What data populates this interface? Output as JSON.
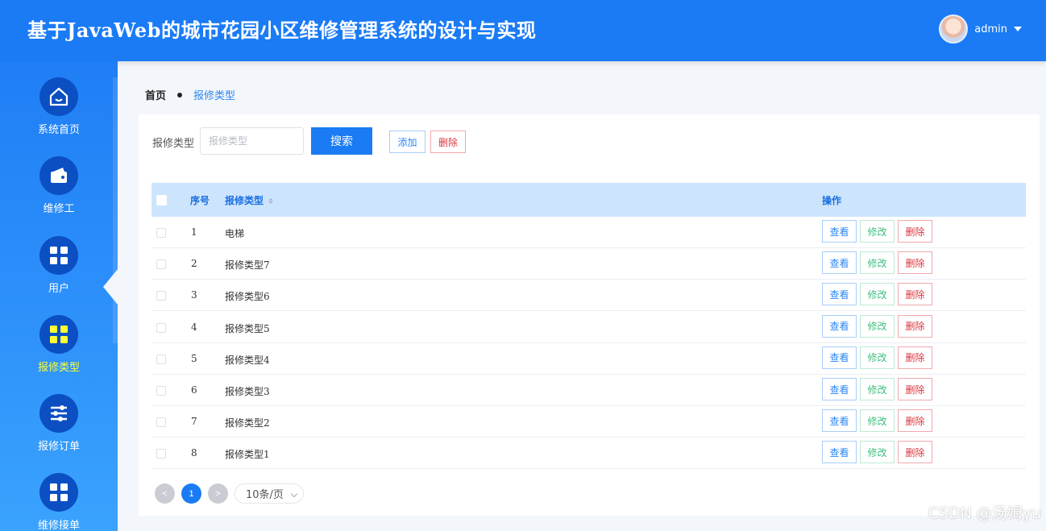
{
  "header": {
    "title": "基于JavaWeb的城市花园小区维修管理系统的设计与实现",
    "username": "admin"
  },
  "sidebar": {
    "items": [
      {
        "label": "系统首页",
        "icon": "home-icon"
      },
      {
        "label": "维修工",
        "icon": "wallet-icon"
      },
      {
        "label": "用户",
        "icon": "grid-icon"
      },
      {
        "label": "报修类型",
        "icon": "grid-icon",
        "active": true
      },
      {
        "label": "报修订单",
        "icon": "sliders-icon"
      },
      {
        "label": "维修接单",
        "icon": "grid-icon"
      }
    ],
    "active_icon_color": "#ffff33"
  },
  "breadcrumb": {
    "home": "首页",
    "current": "报修类型"
  },
  "toolbar": {
    "search_label": "报修类型",
    "search_placeholder": "报修类型",
    "search_button": "搜索",
    "add_button": "添加",
    "delete_button": "删除"
  },
  "table": {
    "columns": {
      "index": "序号",
      "type": "报修类型",
      "actions": "操作"
    },
    "action_labels": {
      "view": "查看",
      "edit": "修改",
      "delete": "删除"
    },
    "rows": [
      {
        "index": "1",
        "type": "电梯"
      },
      {
        "index": "2",
        "type": "报修类型7"
      },
      {
        "index": "3",
        "type": "报修类型6"
      },
      {
        "index": "4",
        "type": "报修类型5"
      },
      {
        "index": "5",
        "type": "报修类型4"
      },
      {
        "index": "6",
        "type": "报修类型3"
      },
      {
        "index": "7",
        "type": "报修类型2"
      },
      {
        "index": "8",
        "type": "报修类型1"
      }
    ]
  },
  "pagination": {
    "prev": "<",
    "current_page": "1",
    "next": ">",
    "page_size": "10条/页"
  },
  "watermark": "CSDN @汤姆yu",
  "colors": {
    "primary": "#1a7bf5",
    "danger": "#d9363e",
    "success": "#3fbf7f"
  }
}
